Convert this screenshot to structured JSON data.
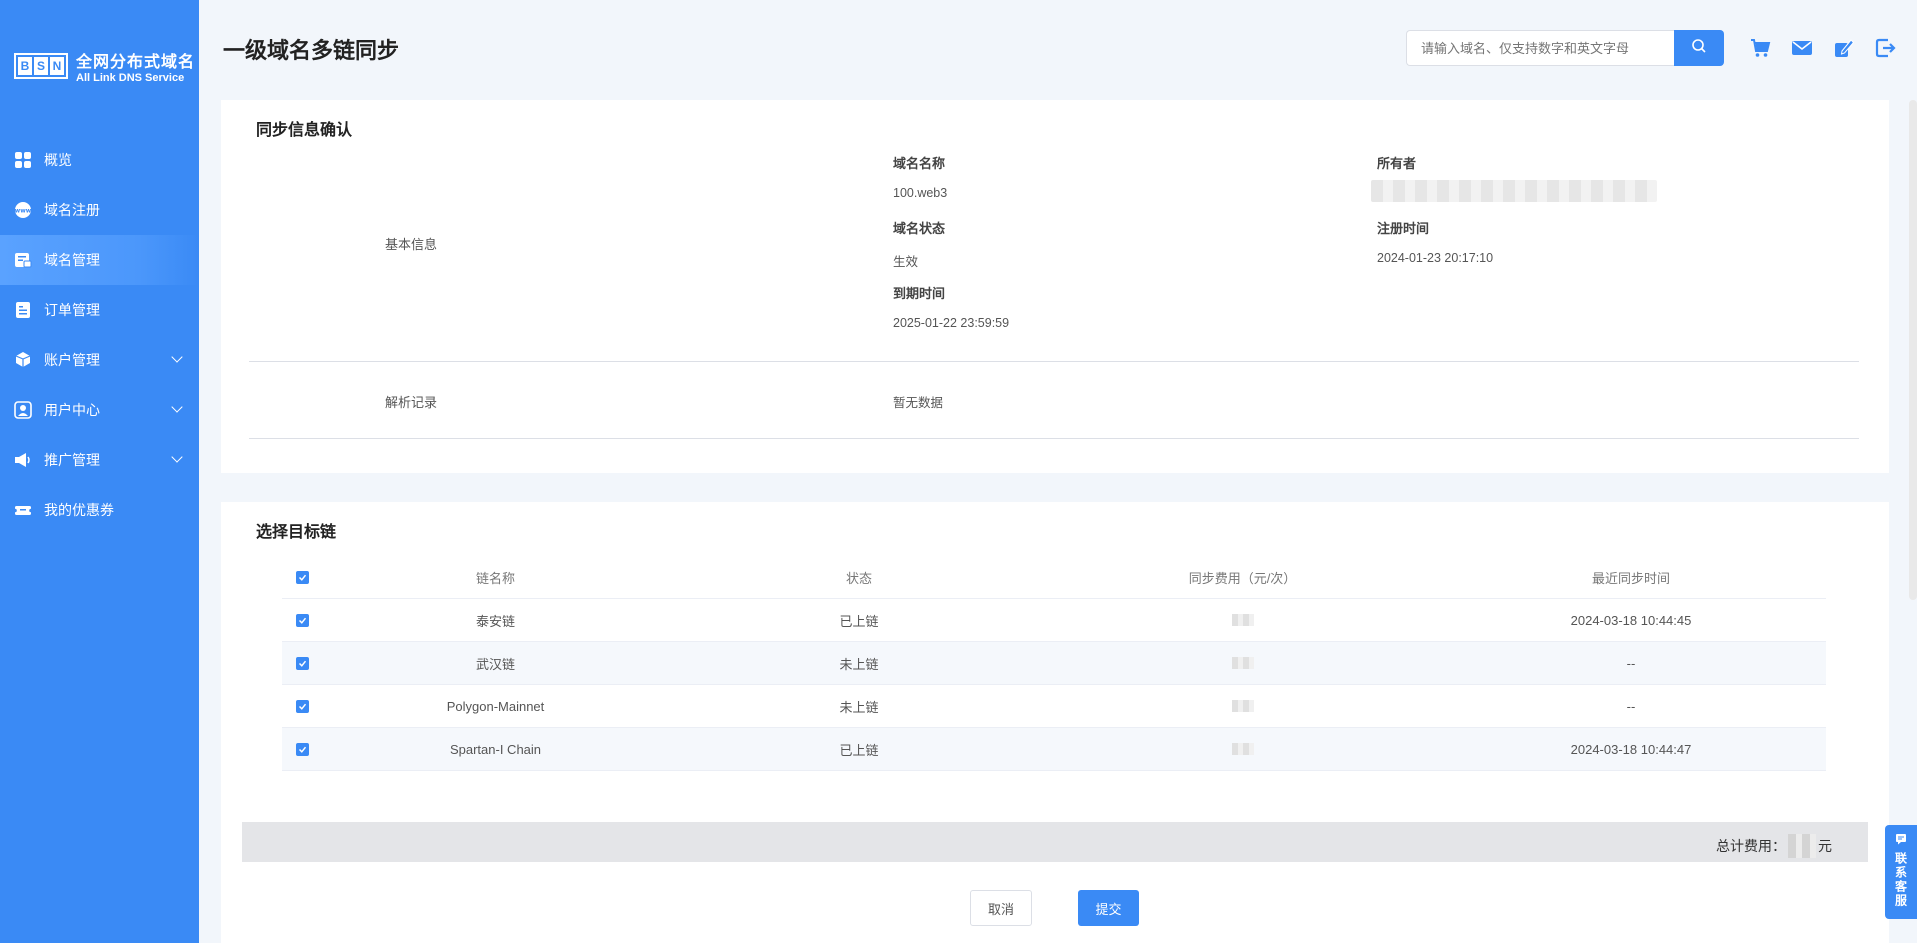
{
  "brand": {
    "letters": [
      "B",
      "S",
      "N"
    ],
    "title": "全网分布式域名",
    "subtitle": "All Link DNS Service"
  },
  "sidebar": {
    "items": [
      {
        "label": "概览",
        "icon": "grid-icon",
        "active": false,
        "expandable": false
      },
      {
        "label": "域名注册",
        "icon": "www-icon",
        "active": false,
        "expandable": false
      },
      {
        "label": "域名管理",
        "icon": "domain-manage-icon",
        "active": true,
        "expandable": false
      },
      {
        "label": "订单管理",
        "icon": "order-icon",
        "active": false,
        "expandable": false
      },
      {
        "label": "账户管理",
        "icon": "account-icon",
        "active": false,
        "expandable": true
      },
      {
        "label": "用户中心",
        "icon": "user-center-icon",
        "active": false,
        "expandable": true
      },
      {
        "label": "推广管理",
        "icon": "megaphone-icon",
        "active": false,
        "expandable": true
      },
      {
        "label": "我的优惠券",
        "icon": "coupon-icon",
        "active": false,
        "expandable": false
      }
    ]
  },
  "header": {
    "title": "一级域名多链同步",
    "search_placeholder": "请输入域名、仅支持数字和英文字母",
    "icons": [
      "cart-icon",
      "mail-icon",
      "edit-icon",
      "logout-icon"
    ]
  },
  "sync_info": {
    "title": "同步信息确认",
    "basic_label": "基本信息",
    "domain_name_label": "域名名称",
    "domain_name_value": "100.web3",
    "owner_label": "所有者",
    "status_label": "域名状态",
    "status_value": "生效",
    "reg_time_label": "注册时间",
    "reg_time_value": "2024-01-23 20:17:10",
    "expire_label": "到期时间",
    "expire_value": "2025-01-22 23:59:59",
    "records_label": "解析记录",
    "records_value": "暂无数据"
  },
  "target_chain": {
    "title": "选择目标链",
    "columns": [
      "链名称",
      "状态",
      "同步费用（元/次）",
      "最近同步时间"
    ],
    "rows": [
      {
        "name": "泰安链",
        "status": "已上链",
        "last_sync": "2024-03-18 10:44:45"
      },
      {
        "name": "武汉链",
        "status": "未上链",
        "last_sync": "--"
      },
      {
        "name": "Polygon-Mainnet",
        "status": "未上链",
        "last_sync": "--"
      },
      {
        "name": "Spartan-I Chain",
        "status": "已上链",
        "last_sync": "2024-03-18 10:44:47"
      }
    ],
    "total_label": "总计费用：",
    "total_unit": "元",
    "cancel_label": "取消",
    "submit_label": "提交"
  },
  "contact": {
    "label": "联系客服"
  },
  "colors": {
    "primary": "#3a8af5",
    "sidebar_bg": "#3a8af5",
    "page_bg": "#f2f6fb"
  }
}
